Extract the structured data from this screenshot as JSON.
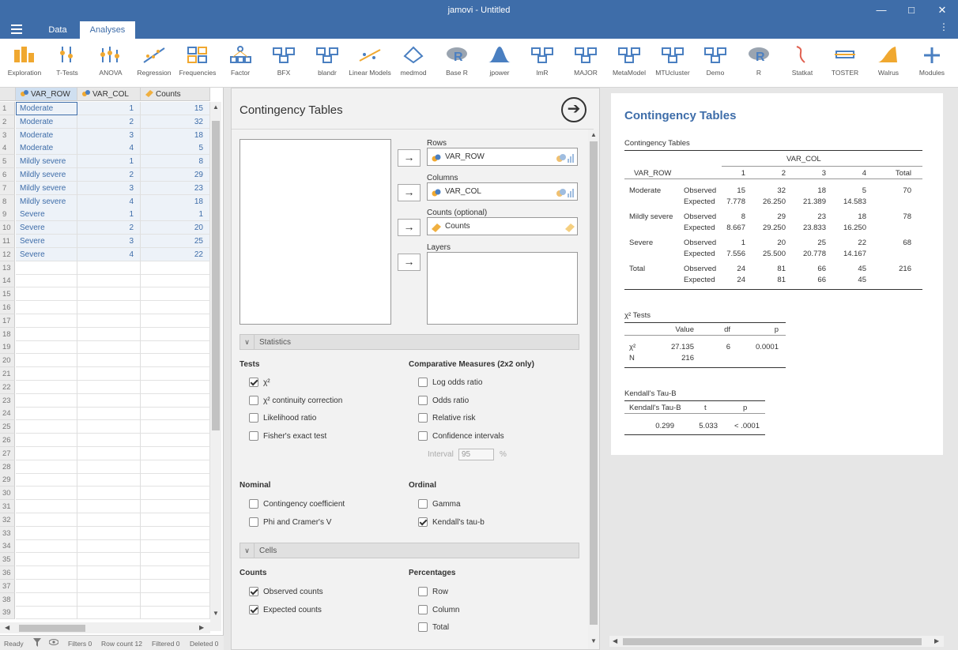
{
  "window": {
    "title": "jamovi - Untitled"
  },
  "tabs": [
    {
      "label": "Data"
    },
    {
      "label": "Analyses"
    }
  ],
  "toolbar": [
    {
      "label": "Exploration"
    },
    {
      "label": "T-Tests"
    },
    {
      "label": "ANOVA"
    },
    {
      "label": "Regression"
    },
    {
      "label": "Frequencies"
    },
    {
      "label": "Factor"
    },
    {
      "label": "BFX"
    },
    {
      "label": "blandr"
    },
    {
      "label": "Linear Models"
    },
    {
      "label": "medmod"
    },
    {
      "label": "Base R"
    },
    {
      "label": "jpower"
    },
    {
      "label": "lmR"
    },
    {
      "label": "MAJOR"
    },
    {
      "label": "MetaModel"
    },
    {
      "label": "MTUcluster"
    },
    {
      "label": "Demo"
    },
    {
      "label": "R"
    },
    {
      "label": "Statkat"
    },
    {
      "label": "TOSTER"
    },
    {
      "label": "Walrus"
    },
    {
      "label": "Modules"
    }
  ],
  "sheet": {
    "columns": [
      "VAR_ROW",
      "VAR_COL",
      "Counts"
    ],
    "rows": [
      [
        "Moderate",
        "1",
        "15"
      ],
      [
        "Moderate",
        "2",
        "32"
      ],
      [
        "Moderate",
        "3",
        "18"
      ],
      [
        "Moderate",
        "4",
        "5"
      ],
      [
        "Mildly severe",
        "1",
        "8"
      ],
      [
        "Mildly severe",
        "2",
        "29"
      ],
      [
        "Mildly severe",
        "3",
        "23"
      ],
      [
        "Mildly severe",
        "4",
        "18"
      ],
      [
        "Severe",
        "1",
        "1"
      ],
      [
        "Severe",
        "2",
        "20"
      ],
      [
        "Severe",
        "3",
        "25"
      ],
      [
        "Severe",
        "4",
        "22"
      ]
    ],
    "row_numbers": [
      "1",
      "2",
      "3",
      "4",
      "5",
      "6",
      "7",
      "8",
      "9",
      "10",
      "11",
      "12",
      "13",
      "14",
      "15",
      "16",
      "17",
      "18",
      "19",
      "20",
      "21",
      "22",
      "23",
      "24",
      "25",
      "26",
      "27",
      "28",
      "29",
      "30",
      "31",
      "32",
      "33",
      "34",
      "35",
      "36",
      "37",
      "38",
      "39"
    ]
  },
  "status": {
    "ready": "Ready",
    "filters": "Filters 0",
    "row_count": "Row count 12",
    "filtered": "Filtered 0",
    "deleted": "Deleted 0"
  },
  "options": {
    "title": "Contingency Tables",
    "rows_label": "Rows",
    "rows_var": "VAR_ROW",
    "columns_label": "Columns",
    "columns_var": "VAR_COL",
    "counts_label": "Counts (optional)",
    "counts_var": "Counts",
    "layers_label": "Layers",
    "statistics_section": "Statistics",
    "tests_head": "Tests",
    "tests": [
      {
        "label": "χ²",
        "checked": true
      },
      {
        "label": "χ² continuity correction",
        "checked": false
      },
      {
        "label": "Likelihood ratio",
        "checked": false
      },
      {
        "label": "Fisher's exact test",
        "checked": false
      }
    ],
    "comparative_head": "Comparative Measures (2x2 only)",
    "comparative": [
      {
        "label": "Log odds ratio",
        "checked": false
      },
      {
        "label": "Odds ratio",
        "checked": false
      },
      {
        "label": "Relative risk",
        "checked": false
      },
      {
        "label": "Confidence intervals",
        "checked": false
      }
    ],
    "interval_label": "Interval",
    "interval_value": "95",
    "interval_unit": "%",
    "nominal_head": "Nominal",
    "nominal": [
      {
        "label": "Contingency coefficient",
        "checked": false
      },
      {
        "label": "Phi and Cramer's V",
        "checked": false
      }
    ],
    "ordinal_head": "Ordinal",
    "ordinal": [
      {
        "label": "Gamma",
        "checked": false
      },
      {
        "label": "Kendall's tau-b",
        "checked": true
      }
    ],
    "cells_section": "Cells",
    "counts_head": "Counts",
    "counts": [
      {
        "label": "Observed counts",
        "checked": true
      },
      {
        "label": "Expected counts",
        "checked": true
      }
    ],
    "percentages_head": "Percentages",
    "percentages": [
      {
        "label": "Row",
        "checked": false
      },
      {
        "label": "Column",
        "checked": false
      },
      {
        "label": "Total",
        "checked": false
      }
    ]
  },
  "results": {
    "title": "Contingency Tables",
    "ct": {
      "caption": "Contingency Tables",
      "col_var": "VAR_COL",
      "row_var": "VAR_ROW",
      "col_headers": [
        "1",
        "2",
        "3",
        "4",
        "Total"
      ],
      "groups": [
        {
          "name": "Moderate",
          "observed_label": "Observed",
          "expected_label": "Expected",
          "observed": [
            "15",
            "32",
            "18",
            "5",
            "70"
          ],
          "expected": [
            "7.778",
            "26.250",
            "21.389",
            "14.583"
          ]
        },
        {
          "name": "Mildly severe",
          "observed_label": "Observed",
          "expected_label": "Expected",
          "observed": [
            "8",
            "29",
            "23",
            "18",
            "78"
          ],
          "expected": [
            "8.667",
            "29.250",
            "23.833",
            "16.250"
          ]
        },
        {
          "name": "Severe",
          "observed_label": "Observed",
          "expected_label": "Expected",
          "observed": [
            "1",
            "20",
            "25",
            "22",
            "68"
          ],
          "expected": [
            "7.556",
            "25.500",
            "20.778",
            "14.167"
          ]
        },
        {
          "name": "Total",
          "observed_label": "Observed",
          "expected_label": "Expected",
          "observed": [
            "24",
            "81",
            "66",
            "45",
            "216"
          ],
          "expected": [
            "24",
            "81",
            "66",
            "45"
          ]
        }
      ]
    },
    "chisq": {
      "caption": "χ² Tests",
      "headers": [
        "Value",
        "df",
        "p"
      ],
      "rows": [
        {
          "label": "χ²",
          "value": "27.135",
          "df": "6",
          "p": "0.0001"
        },
        {
          "label": "N",
          "value": "216",
          "df": "",
          "p": ""
        }
      ]
    },
    "tau": {
      "caption": "Kendall's Tau-B",
      "headers": [
        "Kendall's Tau-B",
        "t",
        "p"
      ],
      "row": {
        "tau": "0.299",
        "t": "5.033",
        "p": "< .0001"
      }
    }
  },
  "colors": {
    "accent": "#3e6da9",
    "toolbar_icon_blue": "#4a7fc1",
    "toolbar_icon_orange": "#f0a830"
  }
}
